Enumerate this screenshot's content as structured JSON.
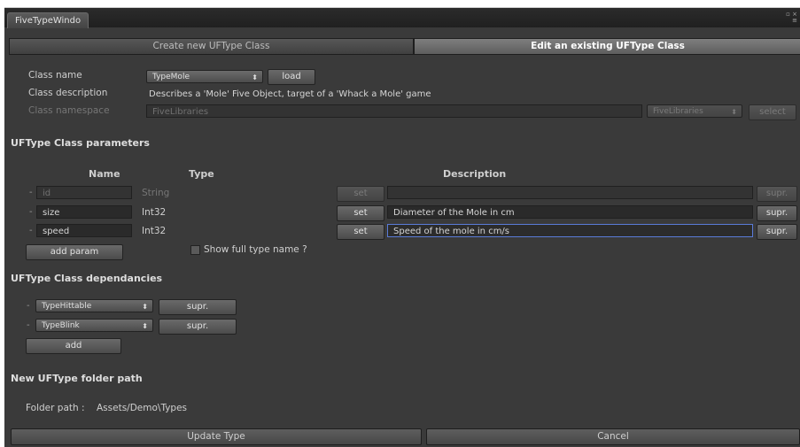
{
  "window": {
    "title": "FiveTypeWindo",
    "corner_glyphs": "▫ ×\n≡"
  },
  "tabs": {
    "create": "Create new UFType Class",
    "edit": "Edit an existing UFType Class"
  },
  "class": {
    "name_label": "Class name",
    "name_value": "TypeMole",
    "load_label": "load",
    "description_label": "Class description",
    "description_value": "Describes a 'Mole' Five Object, target of a 'Whack a Mole' game",
    "namespace_label": "Class namespace",
    "namespace_value": "FiveLibraries",
    "namespace_dropdown": "FiveLibraries",
    "select_label": "select"
  },
  "params": {
    "header": "UFType Class parameters",
    "col_name": "Name",
    "col_type": "Type",
    "col_description": "Description",
    "rows": [
      {
        "minus": "-",
        "name": "id",
        "type": "String",
        "set": "set",
        "description": "",
        "supr": "supr."
      },
      {
        "minus": "-",
        "name": "size",
        "type": "Int32",
        "set": "set",
        "description": "Diameter of the Mole in cm",
        "supr": "supr."
      },
      {
        "minus": "-",
        "name": "speed",
        "type": "Int32",
        "set": "set",
        "description": "Speed of the mole in cm/s",
        "supr": "supr."
      }
    ],
    "add_param_label": "add param",
    "show_full_type_label": "Show full type name ?"
  },
  "deps": {
    "header": "UFType Class dependancies",
    "rows": [
      {
        "minus": "-",
        "value": "TypeHittable",
        "supr": "supr."
      },
      {
        "minus": "-",
        "value": "TypeBlink",
        "supr": "supr."
      }
    ],
    "add_label": "add"
  },
  "folder": {
    "header": "New UFType folder path",
    "path_label": "Folder path :",
    "path_value": "Assets/Demo\\Types"
  },
  "footer": {
    "update_label": "Update Type",
    "cancel_label": "Cancel"
  }
}
